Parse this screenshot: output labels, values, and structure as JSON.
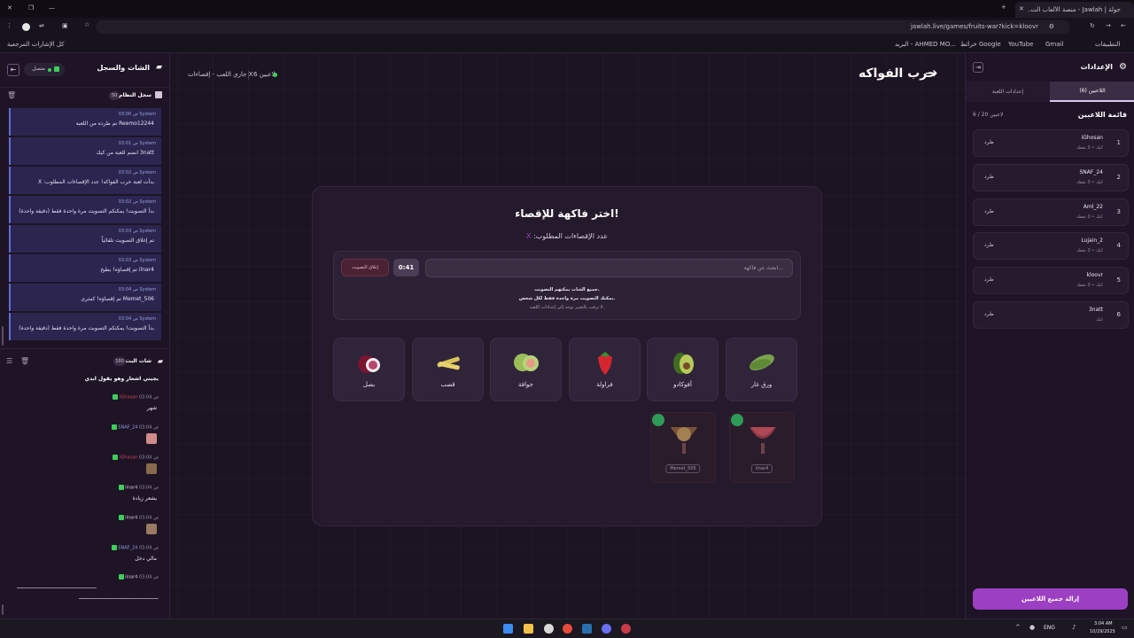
{
  "browser": {
    "tab_title": "جولة | Jawlah - منصة الألعاب الت...",
    "url": "jawlah.live/games/fruits-war?kick=kloovr",
    "bookmarks": [
      "التطبيقات",
      "Gmail",
      "YouTube",
      "خرائط Google",
      "البريد - AHMED MO..."
    ],
    "bookmarks_right": "كل الإشارات المرجعية"
  },
  "left": {
    "header_title": "الشات والسجل",
    "status": "متصل",
    "log_title": "سجل النظام",
    "log_count": "50",
    "log_entries": [
      {
        "meta": "03:00 ص  System",
        "text": "Reemo12244 تم طرده من اللعبة"
      },
      {
        "meta": "03:01 ص  System",
        "text": "3natt انضم للعبة من كيك"
      },
      {
        "meta": "03:02 ص  System",
        "text": "بدأت لعبة حرب الفواكه! عدد الإقصاءات المطلوب: X"
      },
      {
        "meta": "03:02 ص  System",
        "text": "بدأ التصويت! يمكنكم التصويت مرة واحدة فقط (دقيقة واحدة)"
      },
      {
        "meta": "03:03 ص  System",
        "text": "تم إغلاق التصويت تلقائياً"
      },
      {
        "meta": "03:03 ص  System",
        "text": "ilnar4 تم إقصاؤه! بطيخ"
      },
      {
        "meta": "03:04 ص  System",
        "text": "Memet_506 تم إقصاؤه! كمثرى"
      },
      {
        "meta": "03:04 ص  System",
        "text": "بدأ التصويت! يمكنكم التصويت مرة واحدة فقط (دقيقة واحدة)"
      }
    ],
    "chat_title": "شات البث",
    "chat_count": "100",
    "chat_first": "يجيني اشعار وهو يقول ابدي",
    "chat": [
      {
        "user": "iGhosan",
        "time": "03:04 ص",
        "text": "شهر"
      },
      {
        "user": "SNAF_24",
        "time": "03:04 ص",
        "text": ""
      },
      {
        "user": "iGhosan",
        "time": "03:04 ص",
        "text": ""
      },
      {
        "user": "ilnar4",
        "time": "03:04 ص",
        "text": "يشعر زيادة"
      },
      {
        "user": "ilnar4",
        "time": "03:04 ص",
        "text": ""
      },
      {
        "user": "SNAF_24",
        "time": "03:04 ص",
        "text": "مالي دخل"
      },
      {
        "user": "ilnar4",
        "time": "03:04 ص",
        "text": "ـــــــــــــــــــــــــــــــــــــــــــــــــــ"
      }
    ]
  },
  "header": {
    "game_title": "حرب الفواكه",
    "players_count": "6 لاعبين",
    "state": "جاري اللعب - إقصاءات X"
  },
  "main": {
    "title": "اختر فاكهة للإقصاء!",
    "subtitle": "عدد الإقصاءات المطلوب:",
    "subtitle_value": "X",
    "search_placeholder": "ابحث عن فاكهة...",
    "timer": "0:41",
    "close_vote": "إغلاق التصويت",
    "info1": "جميع الشات يمكنهم التصويت.",
    "info2": "يمكنك التصويت مرة واحدة فقط لكل شخص.",
    "info3": "لا ترفب بالتغيير توجه إلى إعدادات اللعبة.",
    "fruits": [
      "ورق غار",
      "أفوكادو",
      "فراولة",
      "جوافة",
      "قصب",
      "بصل"
    ],
    "eliminated": [
      {
        "player": "ilnar4",
        "fruit": "بطيخ"
      },
      {
        "player": "Memet_506",
        "fruit": "كمثرى"
      }
    ]
  },
  "right": {
    "title": "الإعدادات",
    "tab_players": "اللاعبين (6)",
    "tab_settings": "إعدادات اللعبة",
    "list_title": "قائمة اللاعبين",
    "list_count": "6 / 20 لاعبين",
    "kick_label": "طرد",
    "players": [
      {
        "num": "1",
        "name": "iGhosan",
        "sub": "كيك • 0 نقطة"
      },
      {
        "num": "2",
        "name": "SNAF_24",
        "sub": "كيك • 0 نقطة"
      },
      {
        "num": "3",
        "name": "Aml_22",
        "sub": "كيك • 0 نقطة"
      },
      {
        "num": "4",
        "name": "Lujain_2",
        "sub": "كيك • 0 نقطة"
      },
      {
        "num": "5",
        "name": "kloovr",
        "sub": "كيك • 0 نقطة"
      },
      {
        "num": "6",
        "name": "3natt",
        "sub": "كيك"
      }
    ],
    "remove_all": "إزالة جميع اللاعبين"
  },
  "taskbar": {
    "lang": "ENG",
    "time": "3:04 AM",
    "date": "10/29/2025"
  },
  "colors": {
    "accent_purple": "#9c3fc2",
    "kick_green": "#3ccf5a",
    "system_blue": "#5f6fd6"
  }
}
